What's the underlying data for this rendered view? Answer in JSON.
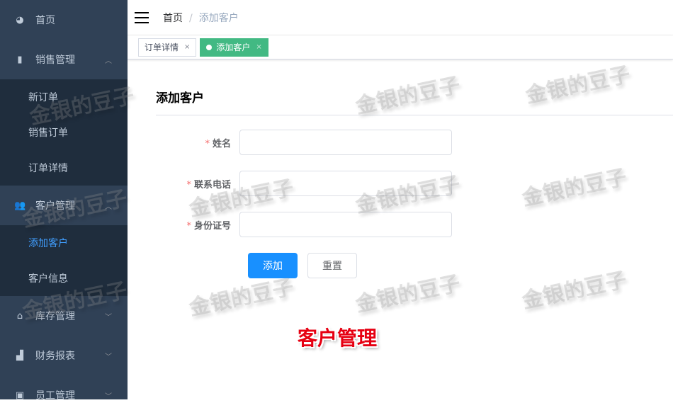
{
  "sidebar": {
    "home": "首页",
    "sales": "销售管理",
    "sales_items": [
      "新订单",
      "销售订单",
      "订单详情"
    ],
    "customer": "客户管理",
    "customer_items": [
      "添加客户",
      "客户信息"
    ],
    "inventory": "库存管理",
    "finance": "财务报表",
    "staff": "员工管理"
  },
  "breadcrumb": {
    "home": "首页",
    "sep": "/",
    "current": "添加客户"
  },
  "tags": [
    {
      "label": "订单详情",
      "close": "×"
    },
    {
      "label": "添加客户",
      "close": "×"
    }
  ],
  "form": {
    "title": "添加客户",
    "required": "*",
    "fields": [
      {
        "label": "姓名",
        "value": ""
      },
      {
        "label": "联系电话",
        "value": ""
      },
      {
        "label": "身份证号",
        "value": ""
      }
    ],
    "submit": "添加",
    "reset": "重置"
  },
  "caption": "客户管理",
  "watermark": "金银的豆子",
  "colors": {
    "sidebar": "#304156",
    "submenu": "#1f2d3d",
    "active": "#409eff",
    "tag_active": "#42b983",
    "primary": "#1890ff"
  }
}
